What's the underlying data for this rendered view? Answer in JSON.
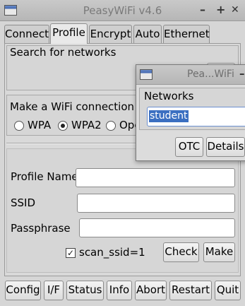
{
  "window": {
    "title": "PeasyWiFi v4.6",
    "minimize": "–",
    "maximize": "+",
    "close": "✕"
  },
  "tabs": [
    {
      "label": "Connect",
      "active": false
    },
    {
      "label": "Profile",
      "active": true
    },
    {
      "label": "Encrypt",
      "active": false
    },
    {
      "label": "Auto",
      "active": false
    },
    {
      "label": "Ethernet",
      "active": false
    }
  ],
  "search": {
    "title": "Search for networks"
  },
  "connection": {
    "title": "Make a WiFi connection pro",
    "options": [
      {
        "label": "WPA",
        "selected": false
      },
      {
        "label": "WPA2",
        "selected": true
      },
      {
        "label": "Ope",
        "selected": false
      }
    ]
  },
  "form": {
    "profile_name_label": "Profile Name",
    "profile_name_value": "",
    "ssid_label": "SSID",
    "ssid_value": "",
    "passphrase_label": "Passphrase",
    "passphrase_value": "",
    "scan_ssid_label": "scan_ssid=1",
    "scan_ssid_checked": true,
    "check_label": "Check",
    "make_label": "Make"
  },
  "bottom_buttons": [
    "Config",
    "I/F",
    "Status",
    "Info",
    "Abort",
    "Restart",
    "Quit"
  ],
  "popup": {
    "title": "Pea...WiFi",
    "title_suffix": "–",
    "group_title": "Networks",
    "network_value": "student",
    "otc_label": "OTC",
    "details_label": "Details"
  },
  "icons": {
    "app": "window-icon",
    "check": "✓"
  }
}
